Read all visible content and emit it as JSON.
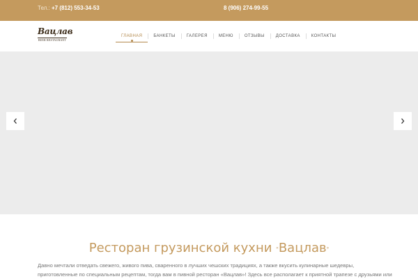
{
  "topbar": {
    "phone_label": "Тел.:",
    "phone_main": "+7 (812) 553-34-53",
    "phone_mobile": "8 (906) 274-99-55"
  },
  "logo": {
    "script": "Вацлав",
    "subtitle": "BEER RESTAURANT"
  },
  "nav": {
    "items": [
      {
        "label": "ГЛАВНАЯ"
      },
      {
        "label": "БАНКЕТЫ"
      },
      {
        "label": "ГАЛЕРЕЯ"
      },
      {
        "label": "МЕНЮ"
      },
      {
        "label": "ОТЗЫВЫ"
      },
      {
        "label": "ДОСТАВКА"
      },
      {
        "label": "КОНТАКТЫ"
      }
    ],
    "active_index": 0
  },
  "slider": {
    "prev_icon": "chevron-left-icon",
    "next_icon": "chevron-right-icon"
  },
  "main": {
    "heading": "Ресторан грузинской кухни",
    "quote_open": "«",
    "heading_name": "Вацлав",
    "quote_close": "»",
    "paragraph_lines": [
      "Давно мечтали отведать свежего, живого пива, сваренного в лучших чешских традициях, а также вкусить кулинарные шедевры,",
      "приготовленные по специальным рецептам, тогда вам в пивной ресторан «Вацлав»! Здесь все располагает к приятной трапезе с друзьями или"
    ]
  },
  "colors": {
    "accent": "#c49a5e",
    "slider_bg": "#ececec",
    "text_muted": "#777777"
  }
}
